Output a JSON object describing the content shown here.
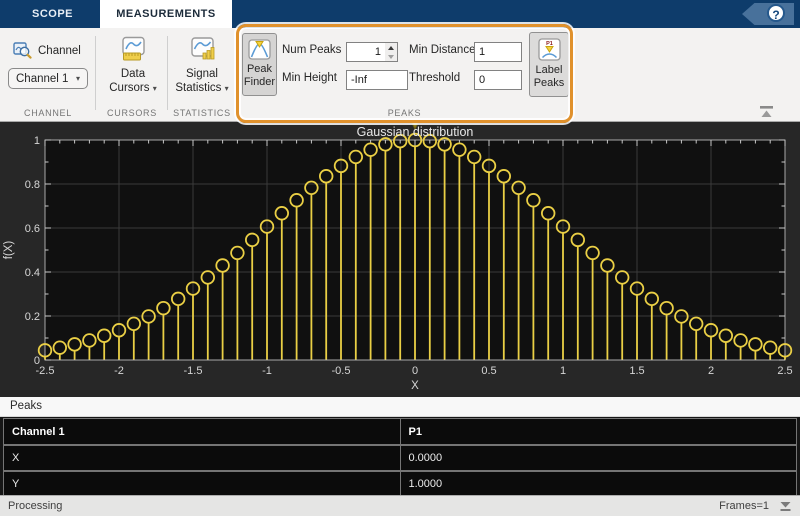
{
  "tabs": {
    "scope": "SCOPE",
    "measurements": "MEASUREMENTS"
  },
  "help_icon": "?",
  "icons": {
    "caret": "▾"
  },
  "toolbar": {
    "channel": {
      "button_label": "Channel",
      "dropdown_value": "Channel 1",
      "section_label": "CHANNEL"
    },
    "cursors": {
      "button_label": "Data Cursors",
      "section_label": "CURSORS"
    },
    "statistics": {
      "button_label": "Signal Statistics",
      "section_label": "STATISTICS"
    },
    "peaks": {
      "peak_finder_label": "Peak Finder",
      "num_peaks_label": "Num Peaks",
      "num_peaks_value": "1",
      "min_height_label": "Min Height",
      "min_height_value": "-Inf",
      "min_distance_label": "Min Distance",
      "min_distance_value": "1",
      "threshold_label": "Threshold",
      "threshold_value": "0",
      "label_peaks_label": "Label Peaks",
      "section_label": "PEAKS",
      "highlight_color": "#E0912C"
    }
  },
  "chart_data": {
    "type": "stem",
    "title": "Gaussian distribution",
    "xlabel": "X",
    "ylabel": "f(X)",
    "xlim": [
      -2.5,
      2.5
    ],
    "ylim": [
      0,
      1
    ],
    "xticks": [
      -2.5,
      -2,
      -1.5,
      -1,
      -0.5,
      0,
      0.5,
      1,
      1.5,
      2,
      2.5
    ],
    "yticks": [
      0,
      0.2,
      0.4,
      0.6,
      0.8,
      1
    ],
    "grid": true,
    "line_color": "#EACF45",
    "plot_background": "#101010",
    "grid_color": "#3A3A3A",
    "x": [
      -2.5,
      -2.4,
      -2.3,
      -2.2,
      -2.1,
      -2.0,
      -1.9,
      -1.8,
      -1.7,
      -1.6,
      -1.5,
      -1.4,
      -1.3,
      -1.2,
      -1.1,
      -1.0,
      -0.9,
      -0.8,
      -0.7,
      -0.6,
      -0.5,
      -0.4,
      -0.3,
      -0.2,
      -0.1,
      0.0,
      0.1,
      0.2,
      0.3,
      0.4,
      0.5,
      0.6,
      0.7,
      0.8,
      0.9,
      1.0,
      1.1,
      1.2,
      1.3,
      1.4,
      1.5,
      1.6,
      1.7,
      1.8,
      1.9,
      2.0,
      2.1,
      2.2,
      2.3,
      2.4,
      2.5
    ],
    "y": [
      0.0439,
      0.0561,
      0.0711,
      0.0889,
      0.1103,
      0.1353,
      0.1645,
      0.1979,
      0.2357,
      0.278,
      0.3247,
      0.3753,
      0.4296,
      0.4868,
      0.5461,
      0.6065,
      0.667,
      0.7261,
      0.7827,
      0.8353,
      0.8825,
      0.9231,
      0.956,
      0.9802,
      0.995,
      1.0,
      0.995,
      0.9802,
      0.956,
      0.9231,
      0.8825,
      0.8353,
      0.7827,
      0.7261,
      0.667,
      0.6065,
      0.5461,
      0.4868,
      0.4296,
      0.3753,
      0.3247,
      0.278,
      0.2357,
      0.1979,
      0.1645,
      0.1353,
      0.1103,
      0.0889,
      0.0711,
      0.0561,
      0.0439
    ],
    "peak_marker": {
      "x": 0,
      "y": 1,
      "color": "#93801F"
    }
  },
  "peaks_panel": {
    "title": "Peaks",
    "table": {
      "headers": [
        "Channel 1",
        "P1"
      ],
      "rows": [
        [
          "X",
          "0.0000"
        ],
        [
          "Y",
          "1.0000"
        ]
      ]
    }
  },
  "statusbar": {
    "left": "Processing",
    "right": "Frames=1"
  }
}
